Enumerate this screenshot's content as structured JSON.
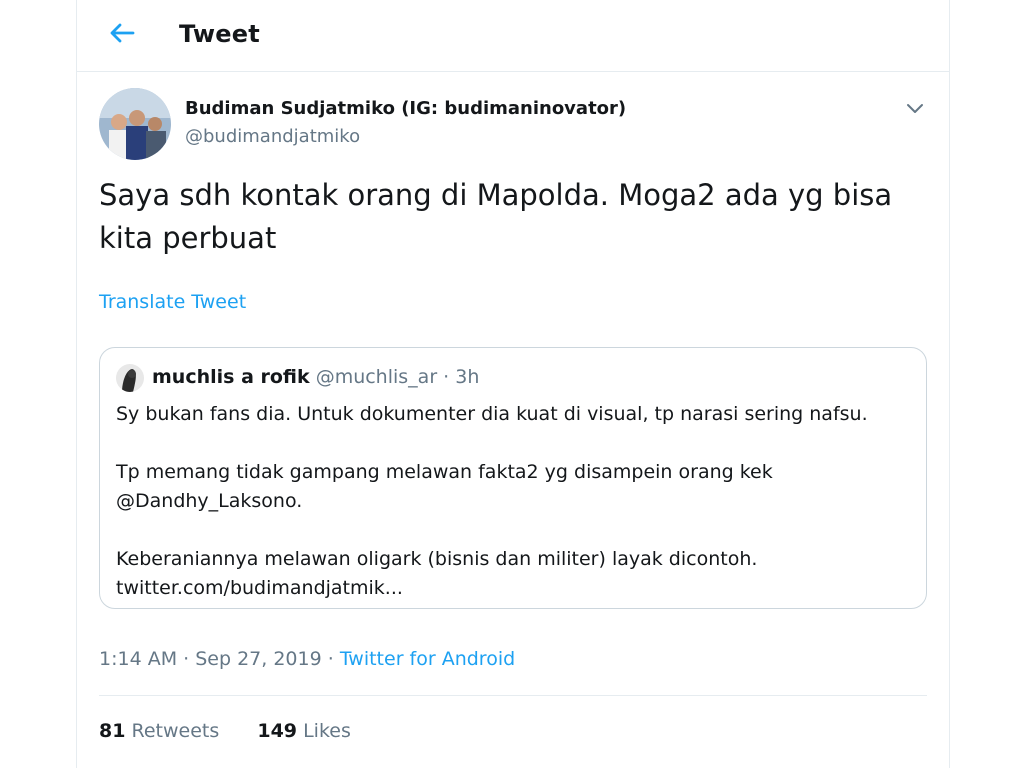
{
  "header": {
    "title": "Tweet"
  },
  "author": {
    "name": "Budiman Sudjatmiko (IG: budimaninovator)",
    "handle": "@budimandjatmiko"
  },
  "tweet": {
    "text": "Saya sdh kontak orang di Mapolda. Moga2 ada yg bisa kita perbuat",
    "translate_label": "Translate Tweet"
  },
  "quoted": {
    "name": "muchlis a rofik",
    "handle": "@muchlis_ar",
    "separator": " · ",
    "time": "3h",
    "lines": [
      "Sy bukan fans dia. Untuk dokumenter dia kuat di visual, tp narasi sering nafsu.",
      "Tp memang tidak gampang melawan fakta2 yg disampein orang kek",
      "@Dandhy_Laksono.",
      "Keberaniannya melawan oligark (bisnis dan militer) layak dicontoh.",
      "twitter.com/budimandjatmik..."
    ]
  },
  "meta": {
    "time": "1:14 AM",
    "separator": " · ",
    "date": "Sep 27, 2019",
    "source": "Twitter for Android"
  },
  "stats": {
    "retweets_count": "81",
    "retweets_label": "Retweets",
    "likes_count": "149",
    "likes_label": "Likes"
  },
  "colors": {
    "accent": "#1da1f2",
    "muted": "#657786",
    "text": "#14171a",
    "border": "#e6ecf0"
  }
}
